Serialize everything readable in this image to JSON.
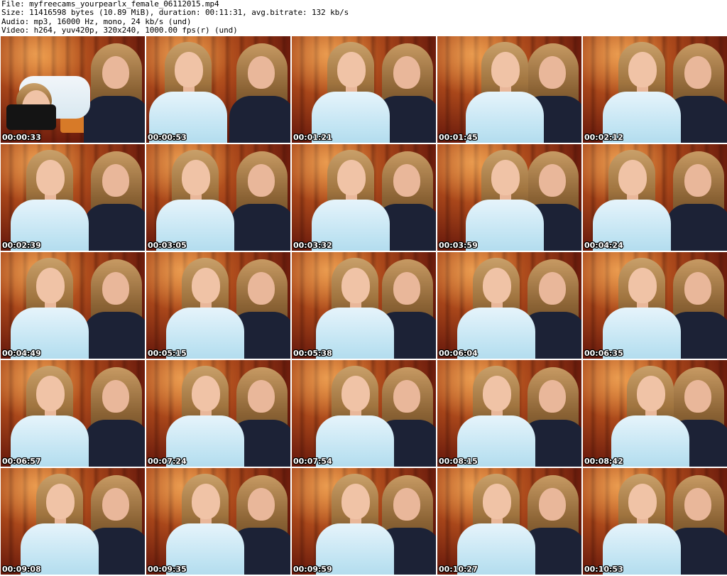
{
  "header": {
    "file": "File: myfreecams_yourpearlx_female_06112015.mp4",
    "size": "Size: 11416598 bytes (10.89 MiB), duration: 00:11:31, avg.bitrate: 132 kb/s",
    "audio": "Audio: mp3, 16000 Hz, mono, 24 kb/s (und)",
    "video": "Video: h264, yuv420p, 320x240, 1000.00 fps(r) (und)"
  },
  "thumbnails": [
    {
      "timestamp": "00:00:33"
    },
    {
      "timestamp": "00:00:53"
    },
    {
      "timestamp": "00:01:21"
    },
    {
      "timestamp": "00:01:45"
    },
    {
      "timestamp": "00:02:12"
    },
    {
      "timestamp": "00:02:39"
    },
    {
      "timestamp": "00:03:05"
    },
    {
      "timestamp": "00:03:32"
    },
    {
      "timestamp": "00:03:59"
    },
    {
      "timestamp": "00:04:24"
    },
    {
      "timestamp": "00:04:49"
    },
    {
      "timestamp": "00:05:15"
    },
    {
      "timestamp": "00:05:38"
    },
    {
      "timestamp": "00:06:04"
    },
    {
      "timestamp": "00:06:35"
    },
    {
      "timestamp": "00:06:57"
    },
    {
      "timestamp": "00:07:24"
    },
    {
      "timestamp": "00:07:54"
    },
    {
      "timestamp": "00:08:15"
    },
    {
      "timestamp": "00:08:42"
    },
    {
      "timestamp": "00:09:08"
    },
    {
      "timestamp": "00:09:35"
    },
    {
      "timestamp": "00:09:59"
    },
    {
      "timestamp": "00:10:27"
    },
    {
      "timestamp": "00:10:53"
    }
  ],
  "colors": {
    "background": "#ffffff",
    "header_text": "#000000",
    "timestamp_text": "#ffffff",
    "timestamp_outline": "#000000"
  }
}
